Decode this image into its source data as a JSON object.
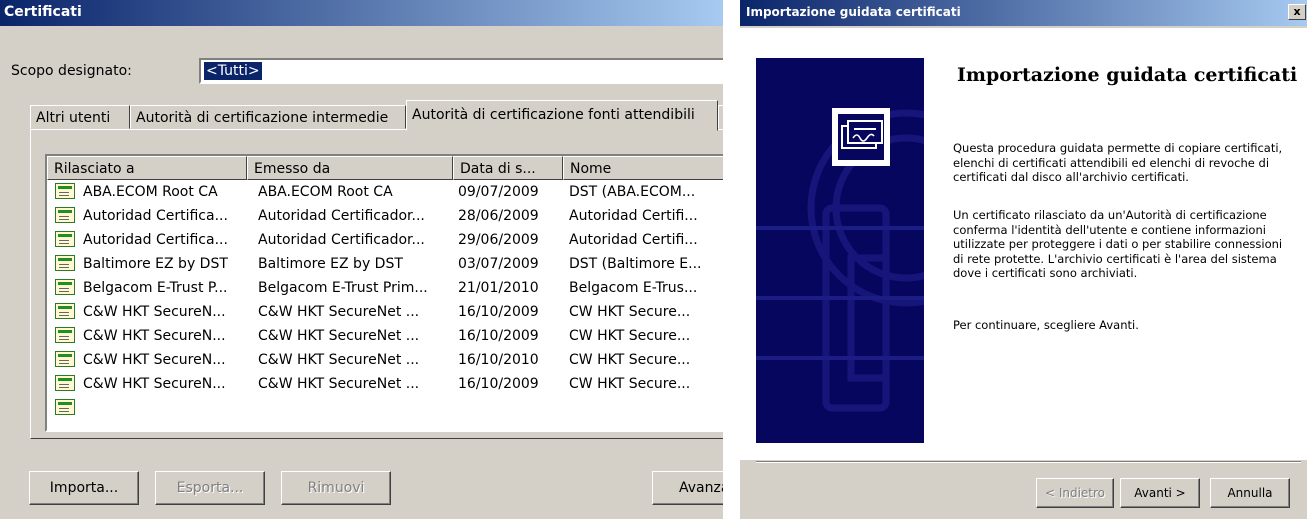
{
  "left_window": {
    "title": "Certificati",
    "scope_label": "Scopo designato:",
    "scope_value": "<Tutti>",
    "tabs": [
      {
        "label": "Altri utenti"
      },
      {
        "label": "Autorità di certificazione intermedie"
      },
      {
        "label": "Autorità di certificazione fonti attendibili"
      }
    ],
    "columns": [
      "Rilasciato a",
      "Emesso da",
      "Data di s...",
      "Nome"
    ],
    "rows": [
      {
        "issued_to": "ABA.ECOM Root CA",
        "issued_by": "ABA.ECOM Root CA",
        "date": "09/07/2009",
        "name": "DST (ABA.ECOM..."
      },
      {
        "issued_to": "Autoridad Certifica...",
        "issued_by": "Autoridad Certificador...",
        "date": "28/06/2009",
        "name": "Autoridad Certifi..."
      },
      {
        "issued_to": "Autoridad Certifica...",
        "issued_by": "Autoridad Certificador...",
        "date": "29/06/2009",
        "name": "Autoridad Certifi..."
      },
      {
        "issued_to": "Baltimore EZ by DST",
        "issued_by": "Baltimore EZ by DST",
        "date": "03/07/2009",
        "name": "DST (Baltimore E..."
      },
      {
        "issued_to": "Belgacom E-Trust P...",
        "issued_by": "Belgacom E-Trust Prim...",
        "date": "21/01/2010",
        "name": "Belgacom E-Trus..."
      },
      {
        "issued_to": "C&W HKT SecureN...",
        "issued_by": "C&W HKT SecureNet ...",
        "date": "16/10/2009",
        "name": "CW HKT Secure..."
      },
      {
        "issued_to": "C&W HKT SecureN...",
        "issued_by": "C&W HKT SecureNet ...",
        "date": "16/10/2009",
        "name": "CW HKT Secure..."
      },
      {
        "issued_to": "C&W HKT SecureN...",
        "issued_by": "C&W HKT SecureNet ...",
        "date": "16/10/2010",
        "name": "CW HKT Secure..."
      },
      {
        "issued_to": "C&W HKT SecureN...",
        "issued_by": "C&W HKT SecureNet ...",
        "date": "16/10/2009",
        "name": "CW HKT Secure..."
      }
    ],
    "buttons": {
      "import": "Importa...",
      "export": "Esporta...",
      "remove": "Rimuovi",
      "advanced": "Avanzate"
    }
  },
  "wizard": {
    "title": "Importazione guidata certificati",
    "close": "x",
    "heading": "Importazione guidata certificati",
    "paragraph1": "Questa procedura guidata permette di copiare certificati, elenchi di certificati attendibili ed elenchi di revoche di certificati dal disco all'archivio certificati.",
    "paragraph2": "Un certificato rilasciato da un'Autorità di certificazione conferma l'identità dell'utente e contiene informazioni utilizzate per proteggere i dati o per stabilire connessioni di rete protette. L'archivio certificati è l'area del sistema dove i certificati sono archiviati.",
    "paragraph3": "Per continuare, scegliere Avanti.",
    "buttons": {
      "back": "< Indietro",
      "next": "Avanti >",
      "cancel": "Annulla"
    }
  },
  "colors": {
    "titlebar_start": "#0a246a",
    "titlebar_end": "#a6caf0",
    "window_bg": "#d4d0c8",
    "banner_bg": "#06065e"
  }
}
